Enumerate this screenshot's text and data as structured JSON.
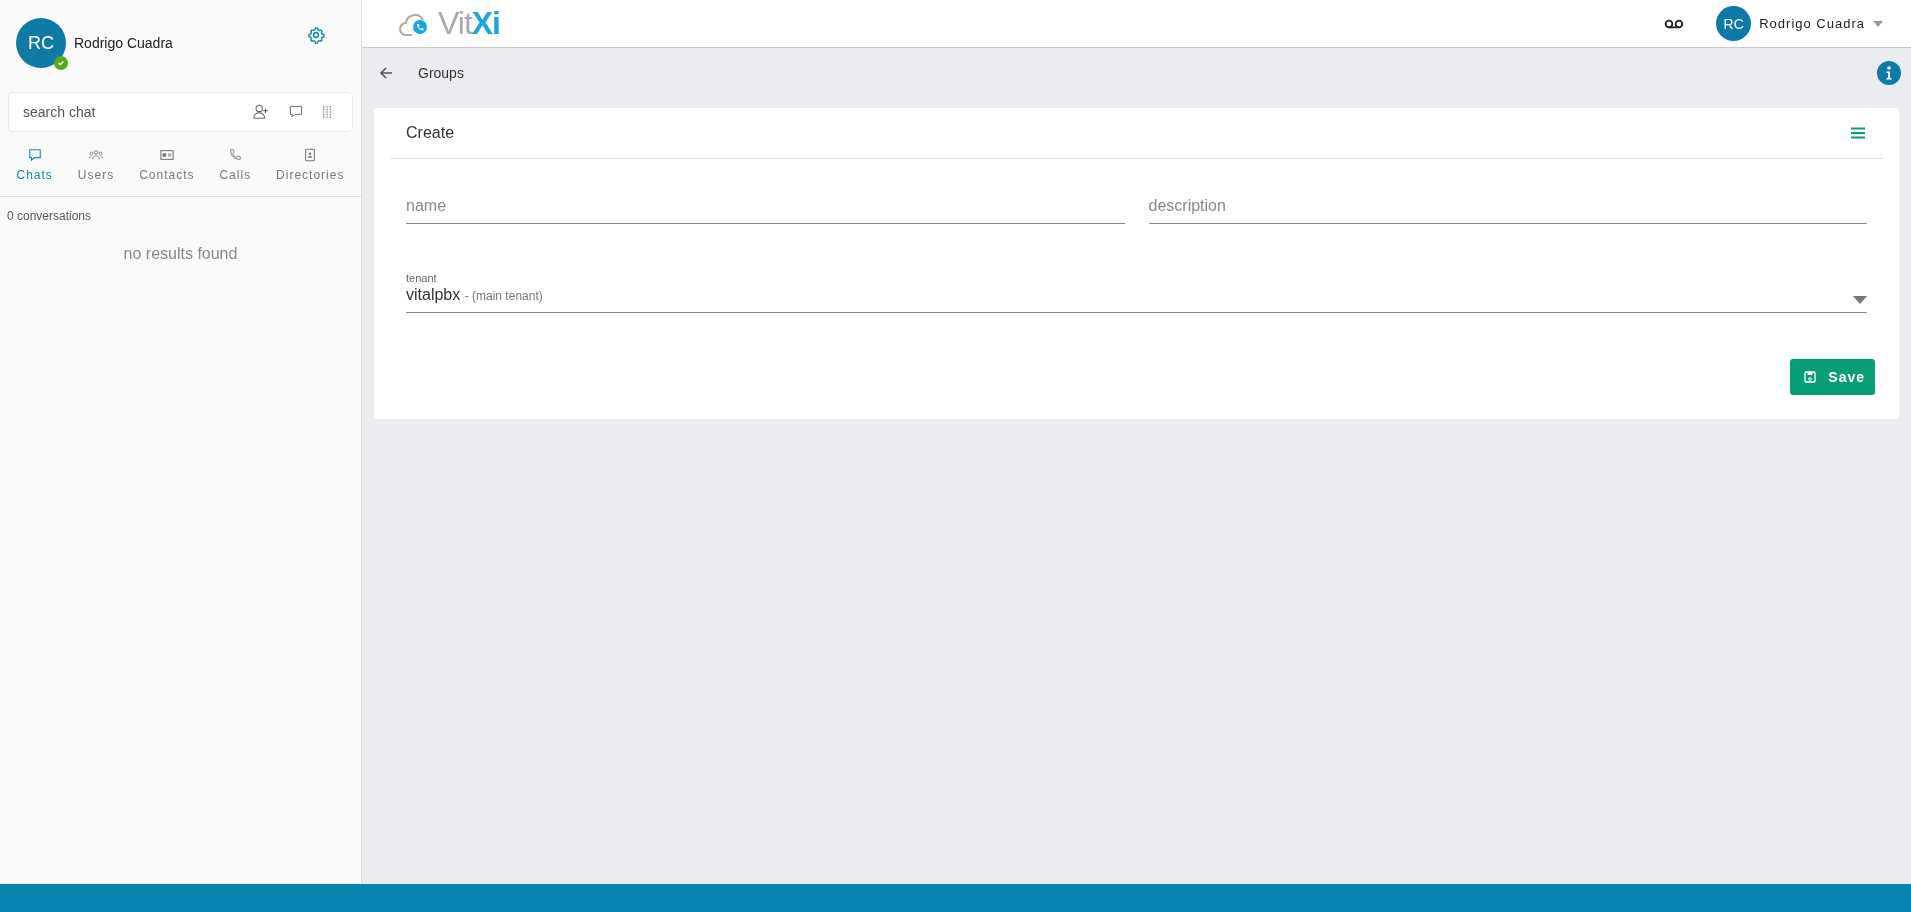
{
  "sidebar": {
    "user": {
      "initials": "RC",
      "name": "Rodrigo Cuadra",
      "online": true
    },
    "search": {
      "placeholder": "search chat"
    },
    "tabs": [
      {
        "label": "Chats",
        "selected": true
      },
      {
        "label": "Users",
        "selected": false
      },
      {
        "label": "Contacts",
        "selected": false
      },
      {
        "label": "Calls",
        "selected": false
      },
      {
        "label": "Directories",
        "selected": false
      }
    ],
    "count": "0 conversations",
    "empty": "no results found"
  },
  "topbar": {
    "logo": "Vit**Xi**",
    "user": {
      "initials": "RC",
      "name": "Rodrigo Cuadra"
    }
  },
  "breadcrumb": "Groups",
  "form": {
    "title": "Create",
    "fields": [
      {
        "placeholder": "name"
      },
      {
        "placeholder": "description"
      }
    ],
    "tenant": {
      "label": "tenant",
      "value": "vitalpbx",
      "note": "- (main tenant)"
    },
    "save": "Save"
  }
}
